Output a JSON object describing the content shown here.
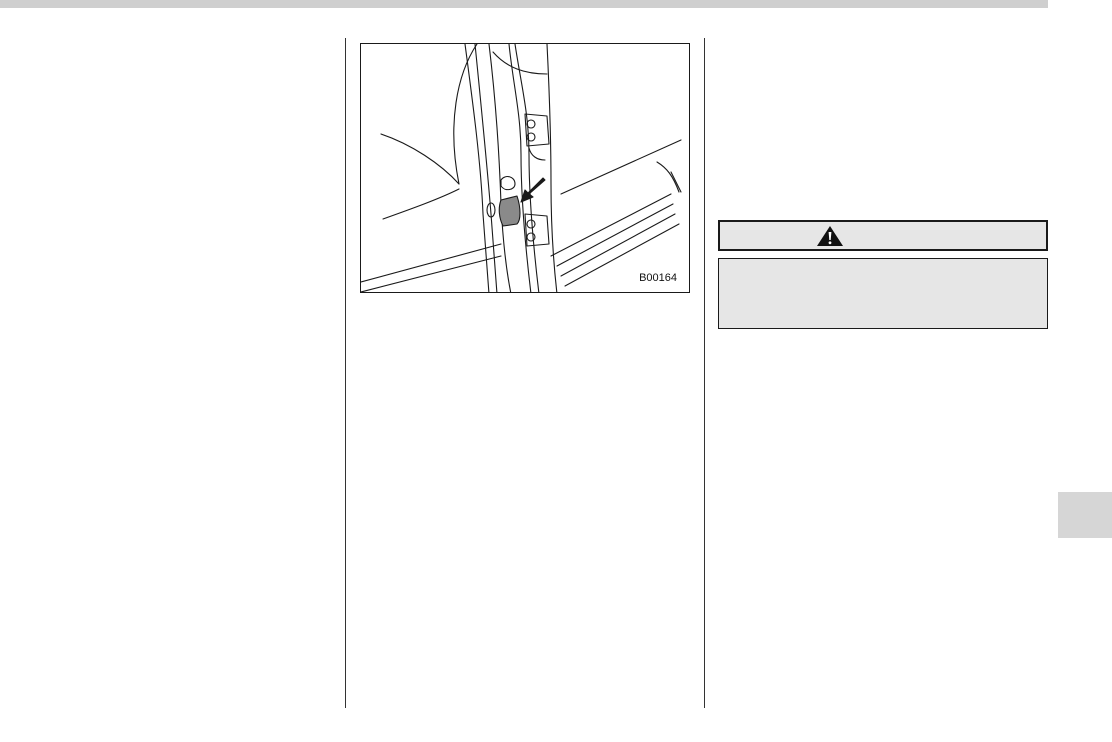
{
  "figure": {
    "code": "B00164",
    "illustration": "door-pillar-check-hole-illustration"
  },
  "warning": {
    "icon": "warning-triangle-icon",
    "header_color": "#e6e6e6",
    "body_color": "#e6e6e6"
  },
  "page": {
    "thumb_tab_color": "#d6d6d6",
    "top_rule_color": "#cfcfcf"
  }
}
